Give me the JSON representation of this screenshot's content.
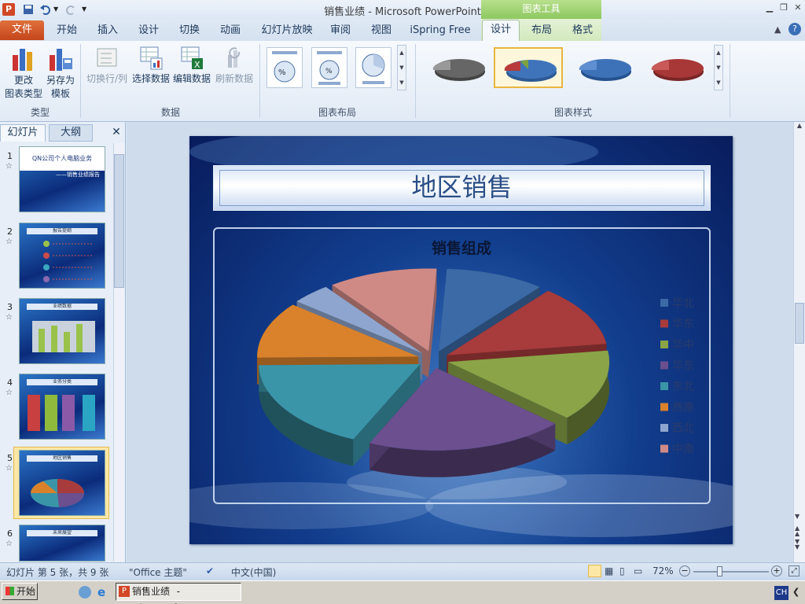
{
  "window": {
    "title": "销售业绩 - Microsoft PowerPoint",
    "context_header": "图表工具"
  },
  "tabs": {
    "file": "文件",
    "home": "开始",
    "insert": "插入",
    "design": "设计",
    "transitions": "切换",
    "animations": "动画",
    "slideshow": "幻灯片放映",
    "review": "审阅",
    "view": "视图",
    "ispring": "iSpring Free",
    "chart_design": "设计",
    "chart_layout": "布局",
    "chart_format": "格式"
  },
  "ribbon": {
    "change_type_l1": "更改",
    "change_type_l2": "图表类型",
    "save_template_l1": "另存为",
    "save_template_l2": "模板",
    "group_type": "类型",
    "switch_rowcol": "切换行/列",
    "select_data": "选择数据",
    "edit_data": "编辑数据",
    "refresh_data": "刷新数据",
    "group_data": "数据",
    "group_layouts": "图表布局",
    "group_styles": "图表样式"
  },
  "panel": {
    "tab_slides": "幻灯片",
    "tab_outline": "大纲",
    "close": "✕"
  },
  "thumbnails": [
    {
      "num": "1",
      "line1": "QN公司个人电脑业务",
      "line2": "——销售业绩报告"
    },
    {
      "num": "2",
      "line1": "报告提纲"
    },
    {
      "num": "3",
      "line1": "业绩数据"
    },
    {
      "num": "4",
      "line1": "业务分类"
    },
    {
      "num": "5",
      "line1": "地区销售"
    },
    {
      "num": "6",
      "line1": "未来展望"
    }
  ],
  "slide": {
    "title": "地区销售"
  },
  "chart_data": {
    "type": "pie",
    "title": "销售组成",
    "legend_position": "right",
    "categories": [
      "华北",
      "华东",
      "华中",
      "华东",
      "东北",
      "西南",
      "西北",
      "中南"
    ],
    "colors": [
      "#3b6aa6",
      "#a83b3b",
      "#8aa447",
      "#6b4f8f",
      "#3b95a8",
      "#d9822b",
      "#8ea6cf",
      "#d08a86"
    ],
    "values": [
      10,
      12,
      14,
      20,
      18,
      11,
      4,
      11
    ]
  },
  "status": {
    "slide_info": "幻灯片 第 5 张，共 9 张",
    "theme": "\"Office 主题\"",
    "language": "中文(中国)",
    "zoom": "72%"
  },
  "taskbar": {
    "start": "开始",
    "item": "销售业绩 - Microsof...",
    "ime": "CH"
  }
}
